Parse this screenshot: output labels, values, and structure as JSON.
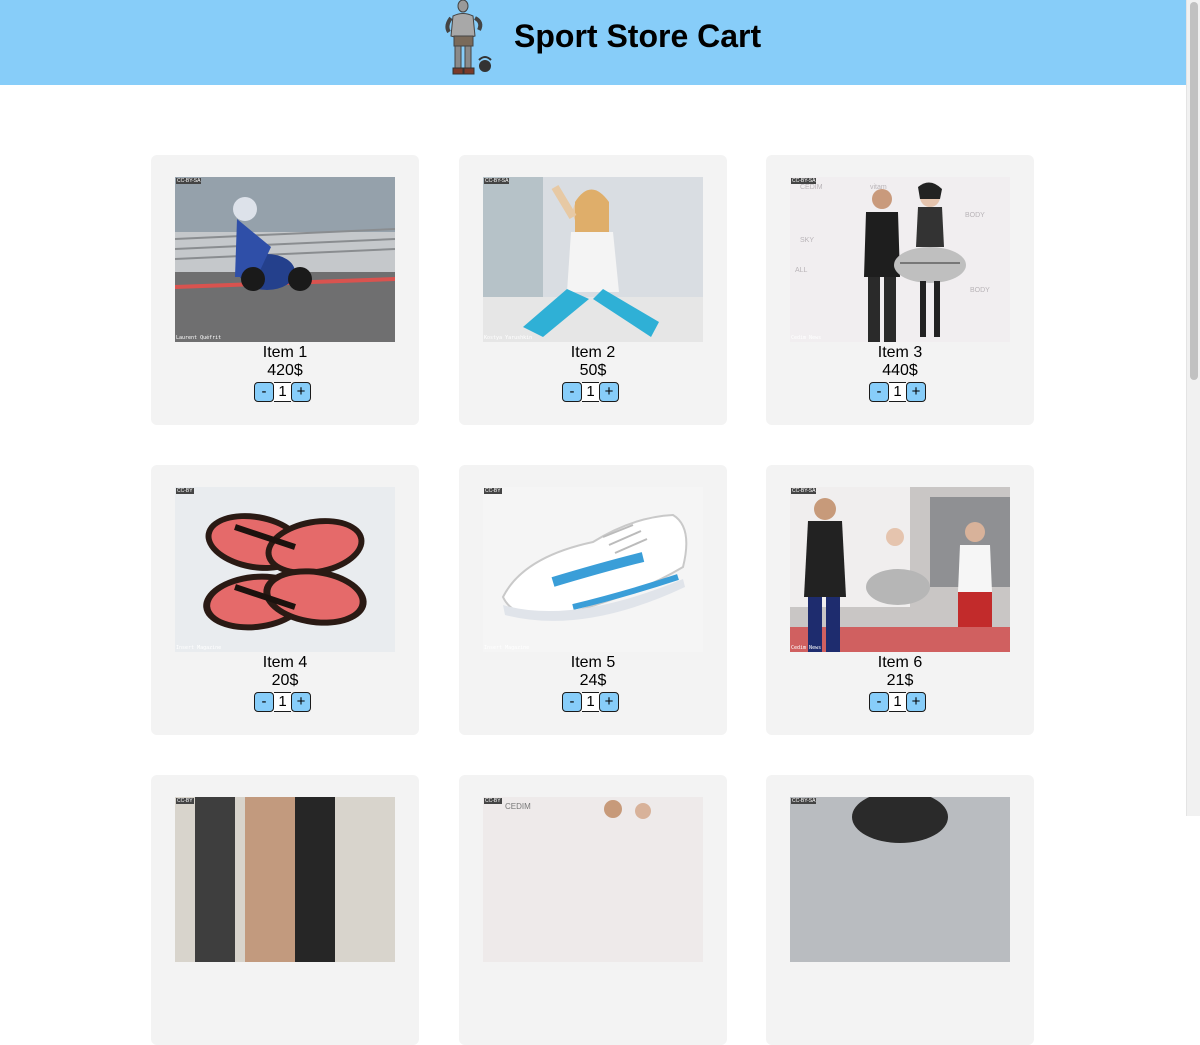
{
  "header": {
    "title": "Sport Store Cart",
    "logo_icon": "bodybuilder-with-kettlebell-icon"
  },
  "colors": {
    "accent": "#87cdf9",
    "card_bg": "#f3f3f3"
  },
  "products": [
    {
      "name": "Item 1",
      "price": "420$",
      "quantity": "1",
      "image": "motorcycle-racer",
      "license": "CC-BY-SA",
      "credit": "Laurent Quéfrit"
    },
    {
      "name": "Item 2",
      "price": "50$",
      "quantity": "1",
      "image": "woman-stretching",
      "license": "CC-BY-SA",
      "credit": "Kostya Yarushkin"
    },
    {
      "name": "Item 3",
      "price": "440$",
      "quantity": "1",
      "image": "fashion-event-couple",
      "license": "CC-BY-SA",
      "credit": "Cedim News"
    },
    {
      "name": "Item 4",
      "price": "20$",
      "quantity": "1",
      "image": "flip-flop-sandals",
      "license": "CC-BY",
      "credit": "Insert Magazine"
    },
    {
      "name": "Item 5",
      "price": "24$",
      "quantity": "1",
      "image": "running-shoe",
      "license": "CC-BY",
      "credit": "Insert Magazine"
    },
    {
      "name": "Item 6",
      "price": "21$",
      "quantity": "1",
      "image": "fashion-event-group",
      "license": "CC-BY-SA",
      "credit": "Cedim News"
    }
  ],
  "controls": {
    "decrement_label": "-",
    "increment_label": "+"
  },
  "partial_row": [
    {
      "image": "people-gym",
      "license": "CC-BY"
    },
    {
      "image": "fashion-event-cedim",
      "license": "CC-BY"
    },
    {
      "image": "person-beanie",
      "license": "CC-BY-SA"
    }
  ]
}
